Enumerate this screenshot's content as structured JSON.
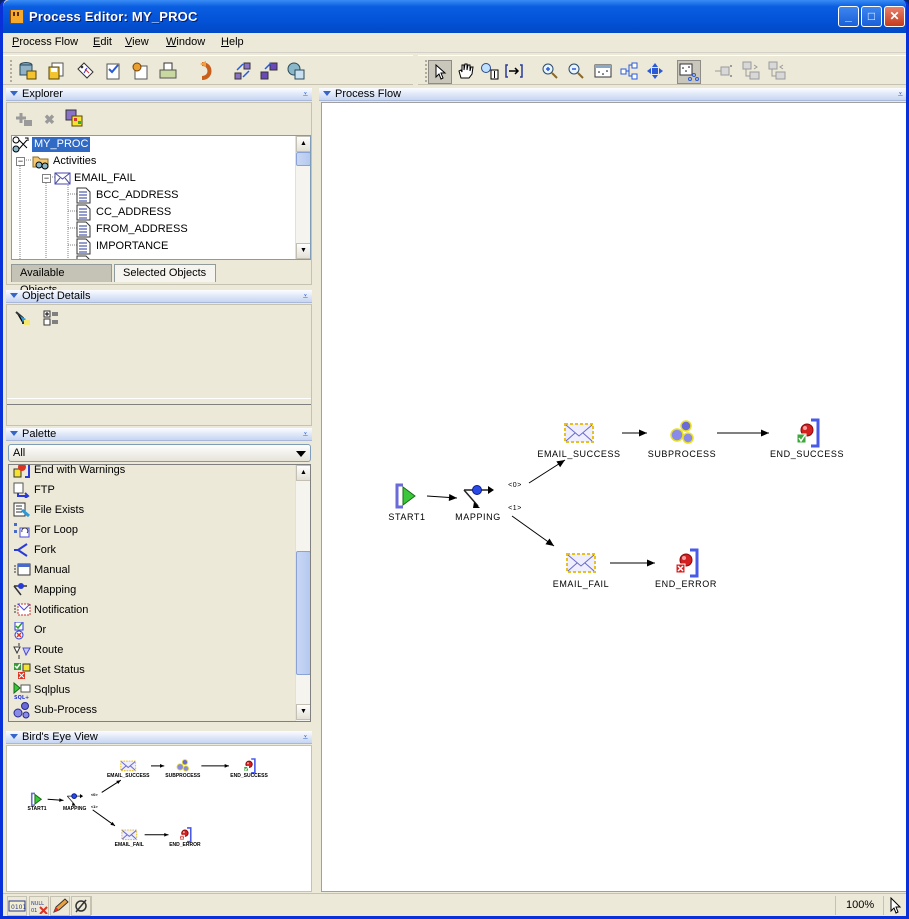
{
  "window": {
    "title": "Process Editor: MY_PROC",
    "controls": [
      "minimize",
      "maximize",
      "close"
    ]
  },
  "menubar": {
    "items": [
      {
        "label": "Process Flow",
        "mnemonic": "P"
      },
      {
        "label": "Edit",
        "mnemonic": "E"
      },
      {
        "label": "View",
        "mnemonic": "V"
      },
      {
        "label": "Window",
        "mnemonic": "W"
      },
      {
        "label": "Help",
        "mnemonic": "H"
      }
    ]
  },
  "toolbar_left": {
    "icons": [
      "repository-save-icon",
      "save-all-icon",
      "tag-icon",
      "validate-icon",
      "generate-icon",
      "print-icon",
      "undo-icon",
      "auto-layout-icon",
      "fit-icon",
      "deploy-icon"
    ]
  },
  "toolbar_right": {
    "icons": [
      "select-pointer-icon",
      "pan-hand-icon",
      "zoom-region-icon",
      "fit-to-window-icon",
      "zoom-in-icon",
      "zoom-out-icon",
      "grid-icon",
      "tree-layout-icon",
      "spread-icon",
      "birds-eye-toggle-icon",
      "collapse-icon",
      "expand-child-icon",
      "expand-parent-icon"
    ],
    "pressed": [
      "select-pointer-icon",
      "birds-eye-toggle-icon"
    ]
  },
  "explorer": {
    "title": "Explorer",
    "toolbar": [
      "add-icon",
      "delete-icon",
      "properties-icon"
    ],
    "tree": [
      {
        "label": "MY_PROC",
        "level": 0,
        "selected": true,
        "icon": "process-icon"
      },
      {
        "label": "Activities",
        "level": 1,
        "expanded": true,
        "icon": "activities-icon"
      },
      {
        "label": "EMAIL_FAIL",
        "level": 2,
        "expanded": true,
        "icon": "email-icon"
      },
      {
        "label": "BCC_ADDRESS",
        "level": 3,
        "icon": "param-icon"
      },
      {
        "label": "CC_ADDRESS",
        "level": 3,
        "icon": "param-icon"
      },
      {
        "label": "FROM_ADDRESS",
        "level": 3,
        "icon": "param-icon"
      },
      {
        "label": "IMPORTANCE",
        "level": 3,
        "icon": "param-icon"
      }
    ],
    "tabs": [
      {
        "label": "Available Objects",
        "active": true
      },
      {
        "label": "Selected Objects",
        "active": false
      }
    ]
  },
  "object_details": {
    "title": "Object Details",
    "toolbar": [
      "filter-icon",
      "expand-all-icon"
    ]
  },
  "palette": {
    "title": "Palette",
    "filter": "All",
    "items": [
      {
        "label": "End with Warnings",
        "icon": "end-warning-icon"
      },
      {
        "label": "FTP",
        "icon": "ftp-icon"
      },
      {
        "label": "File Exists",
        "icon": "file-exists-icon"
      },
      {
        "label": "For Loop",
        "icon": "for-loop-icon"
      },
      {
        "label": "Fork",
        "icon": "fork-icon"
      },
      {
        "label": "Manual",
        "icon": "manual-icon"
      },
      {
        "label": "Mapping",
        "icon": "mapping-icon"
      },
      {
        "label": "Notification",
        "icon": "notification-icon"
      },
      {
        "label": "Or",
        "icon": "or-icon"
      },
      {
        "label": "Route",
        "icon": "route-icon"
      },
      {
        "label": "Set Status",
        "icon": "set-status-icon"
      },
      {
        "label": "Sqlplus",
        "icon": "sqlplus-icon"
      },
      {
        "label": "Sub-Process",
        "icon": "subprocess-icon"
      }
    ]
  },
  "birds_eye": {
    "title": "Bird's Eye View"
  },
  "process_flow": {
    "title": "Process Flow",
    "nodes": [
      {
        "id": "start1",
        "label": "START1",
        "type": "start"
      },
      {
        "id": "mapping",
        "label": "MAPPING",
        "type": "mapping"
      },
      {
        "id": "email_success",
        "label": "EMAIL_SUCCESS",
        "type": "email"
      },
      {
        "id": "subprocess",
        "label": "SUBPROCESS",
        "type": "subprocess"
      },
      {
        "id": "end_success",
        "label": "END_SUCCESS",
        "type": "end-success"
      },
      {
        "id": "email_fail",
        "label": "EMAIL_FAIL",
        "type": "email"
      },
      {
        "id": "end_error",
        "label": "END_ERROR",
        "type": "end-error"
      }
    ],
    "edges": [
      {
        "from": "start1",
        "to": "mapping",
        "label": ""
      },
      {
        "from": "mapping",
        "to": "email_success",
        "label": "<0>"
      },
      {
        "from": "mapping",
        "to": "email_fail",
        "label": "<1>"
      },
      {
        "from": "email_success",
        "to": "subprocess",
        "label": ""
      },
      {
        "from": "subprocess",
        "to": "end_success",
        "label": ""
      },
      {
        "from": "email_fail",
        "to": "end_error",
        "label": ""
      }
    ]
  },
  "statusbar": {
    "buttons": [
      "binary-icon",
      "clear-binary-icon",
      "edit-pencil-icon",
      "null-icon"
    ],
    "zoom": "100%"
  }
}
